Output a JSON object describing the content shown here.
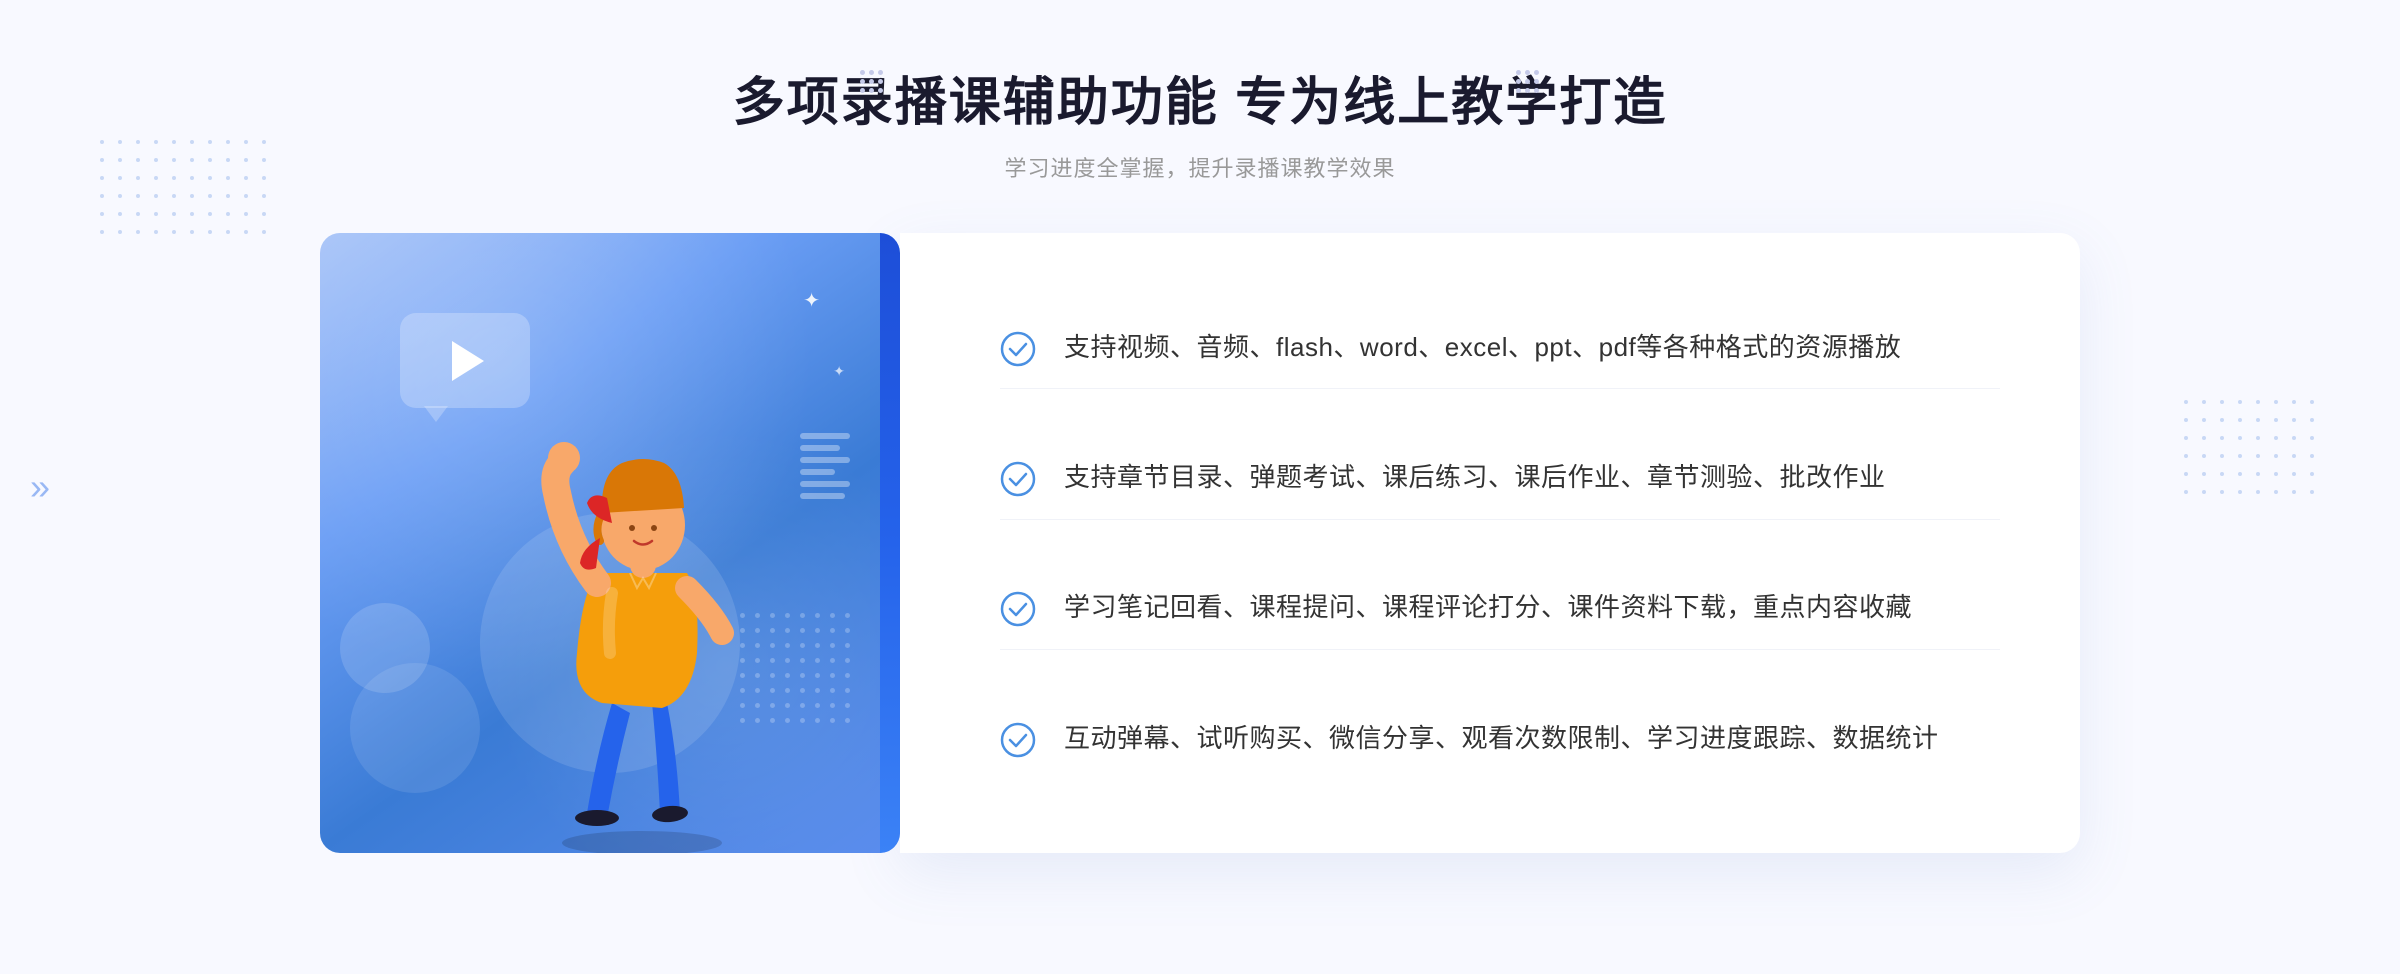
{
  "header": {
    "main_title": "多项录播课辅助功能 专为线上教学打造",
    "sub_title": "学习进度全掌握，提升录播课教学效果"
  },
  "features": [
    {
      "id": 1,
      "text": "支持视频、音频、flash、word、excel、ppt、pdf等各种格式的资源播放"
    },
    {
      "id": 2,
      "text": "支持章节目录、弹题考试、课后练习、课后作业、章节测验、批改作业"
    },
    {
      "id": 3,
      "text": "学习笔记回看、课程提问、课程评论打分、课件资料下载，重点内容收藏"
    },
    {
      "id": 4,
      "text": "互动弹幕、试听购买、微信分享、观看次数限制、学习进度跟踪、数据统计"
    }
  ],
  "colors": {
    "primary_blue": "#3a7bd5",
    "light_blue": "#6b9ef5",
    "check_color": "#4a90e2",
    "title_color": "#1a1a2e",
    "text_color": "#333333",
    "subtitle_color": "#999999"
  },
  "icons": {
    "play": "▶",
    "check": "✓",
    "left_arrow": "»",
    "sparkle": "✦"
  }
}
